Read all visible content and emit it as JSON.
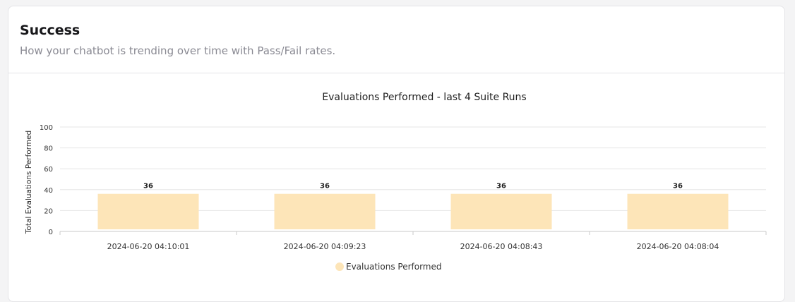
{
  "card": {
    "title": "Success",
    "subtitle": "How your chatbot is trending over time with Pass/Fail rates."
  },
  "colors": {
    "bar_fill": "#fde5b8",
    "grid": "#e5e5e5",
    "axis": "#c8c8c8",
    "text": "#333333"
  },
  "chart_data": {
    "type": "bar",
    "title": "Evaluations Performed - last 4 Suite Runs",
    "xlabel": "",
    "ylabel": "Total Evaluations Performed",
    "categories": [
      "2024-06-20 04:10:01",
      "2024-06-20 04:09:23",
      "2024-06-20 04:08:43",
      "2024-06-20 04:08:04"
    ],
    "series": [
      {
        "name": "Evaluations Performed",
        "values": [
          36,
          36,
          36,
          36
        ]
      }
    ],
    "data_labels": [
      "36",
      "36",
      "36",
      "36"
    ],
    "ylim": [
      0,
      100
    ],
    "yticks": [
      0,
      20,
      40,
      60,
      80,
      100
    ],
    "grid": true,
    "legend_position": "bottom"
  }
}
